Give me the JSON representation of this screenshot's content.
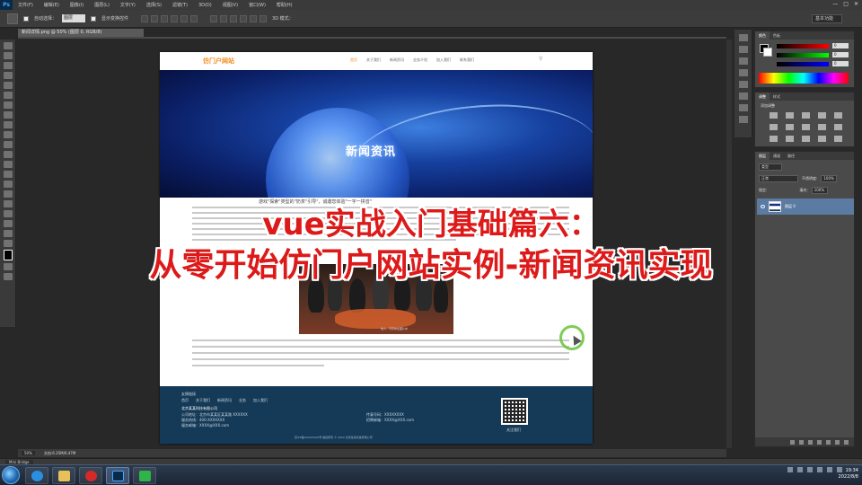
{
  "app": {
    "logo": "Ps",
    "menu": [
      "文件(F)",
      "编辑(E)",
      "图像(I)",
      "图层(L)",
      "文字(Y)",
      "选择(S)",
      "滤镜(T)",
      "3D(D)",
      "视图(V)",
      "窗口(W)",
      "帮助(H)"
    ],
    "window_controls": [
      "—",
      "□",
      "✕"
    ]
  },
  "options_bar": {
    "auto_select_label": "自动选择：",
    "auto_select_value": "图层",
    "show_transform_label": "显示变换控件",
    "mode_3d_label": "3D 模式：",
    "workspace": "基本功能"
  },
  "document": {
    "tab_title": "新闻详情.png @ 50% (图层 0, RGB/8)",
    "zoom": "50%",
    "doc_info": "文档:6.35M/6.47M"
  },
  "site": {
    "logo": "仿门户网站",
    "nav": [
      "首页",
      "关于我们",
      "新闻资讯",
      "业务介绍",
      "加入我们",
      "联系我们"
    ],
    "search_icon": "search-icon",
    "banner_title": "新闻资讯",
    "article_heading": "游戏\"探索\"类型的\"奶茶\"引导\"，诚邀您体验\"一字一拼音\"",
    "photo_caption": "他人，可有你在图片中",
    "footer": {
      "links_title": "友情链接",
      "links": [
        "首页",
        "关于我们",
        "新闻资讯",
        "业务",
        "加入我们"
      ],
      "company": "北京某某科技有限公司",
      "address": "公司地址：北京市某某区某某路 XXXXXX",
      "phone": "服务热线：400-XXXXXXX",
      "email": "服务邮箱：XXXX@XXX.com",
      "fax": "传真号码：XXXXXXXX",
      "hr_email": "招聘邮箱：XXXX@XXX.com",
      "qr_caption": "关注我们",
      "copyright": "京ICP备XXXXXXXX号  版权所有 © 2022 北京某某科技有限公司"
    }
  },
  "panels": {
    "color_tabs": [
      "颜色",
      "色板"
    ],
    "rgb_values": [
      "0",
      "0",
      "0"
    ],
    "adjust_tabs": [
      "调整",
      "样式"
    ],
    "adjust_label": "添加调整",
    "layers_tabs": [
      "图层",
      "通道",
      "路径"
    ],
    "kind_label": "类型",
    "blend_mode": "正常",
    "opacity_label": "不透明度:",
    "opacity_value": "100%",
    "lock_label": "锁定:",
    "fill_label": "填充:",
    "fill_value": "100%",
    "layer_name": "图层 0"
  },
  "minibridge": "Mini Bridge",
  "taskbar": {
    "time": "19:34",
    "date": "2022/8/8"
  },
  "caption": {
    "line1": "vue实战入门基础篇六：",
    "line2": "从零开始仿门户网站实例-新闻资讯实现"
  }
}
